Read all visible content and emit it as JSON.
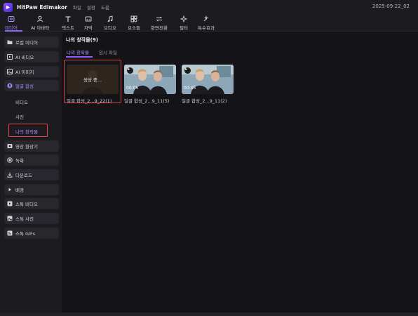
{
  "titlebar": {
    "app_name": "HitPaw Edimakor",
    "menus": [
      "파일",
      "설정",
      "도움"
    ],
    "date": "2025-09-22_02"
  },
  "toolbar": {
    "items": [
      {
        "label": "미디어",
        "icon": "media-icon",
        "active": true
      },
      {
        "label": "AI 아바타",
        "icon": "avatar-icon",
        "active": false
      },
      {
        "label": "텍스트",
        "icon": "text-icon",
        "active": false
      },
      {
        "label": "자막",
        "icon": "subtitle-icon",
        "active": false
      },
      {
        "label": "오디오",
        "icon": "audio-icon",
        "active": false
      },
      {
        "label": "요소들",
        "icon": "elements-icon",
        "active": false
      },
      {
        "label": "화면전환",
        "icon": "transition-icon",
        "active": false
      },
      {
        "label": "필터",
        "icon": "filter-icon",
        "active": false
      },
      {
        "label": "특수효과",
        "icon": "effects-icon",
        "active": false
      }
    ]
  },
  "sidebar": {
    "items": [
      {
        "label": "로컬 미디어",
        "icon": "folder-icon"
      },
      {
        "label": "AI 비디오",
        "icon": "ai-video-icon"
      },
      {
        "label": "AI 이미지",
        "icon": "ai-image-icon"
      },
      {
        "label": "얼굴 합성",
        "icon": "face-swap-icon",
        "active": true
      },
      {
        "label": "영상 향상기",
        "icon": "enhancer-icon"
      },
      {
        "label": "녹화",
        "icon": "record-icon"
      },
      {
        "label": "다운로드",
        "icon": "download-icon"
      },
      {
        "label": "배경",
        "icon": "background-icon"
      },
      {
        "label": "스톡 비디오",
        "icon": "stock-video-icon"
      },
      {
        "label": "스톡 사진",
        "icon": "stock-photo-icon"
      },
      {
        "label": "스톡 GIFs",
        "icon": "stock-gif-icon"
      }
    ],
    "subitems": [
      {
        "label": "비디오"
      },
      {
        "label": "사진"
      },
      {
        "label": "나의 창작물",
        "active": true
      }
    ]
  },
  "main": {
    "title": "나의 창작물(9)",
    "tabs": [
      {
        "label": "나의 창작물",
        "active": true
      },
      {
        "label": "임시 파일",
        "active": false
      }
    ],
    "cards": [
      {
        "label": "얼굴 합성_2...9_22(1)",
        "overlay": "생성 중...",
        "duration": "",
        "status": "generating"
      },
      {
        "label": "얼굴 합성_2...9_11(5)",
        "overlay": "",
        "duration": "00:05",
        "status": "done"
      },
      {
        "label": "얼굴 합성_2...9_11(2)",
        "overlay": "",
        "duration": "00:05",
        "status": "done"
      }
    ]
  },
  "colors": {
    "accent": "#8b63ff",
    "highlight_box": "#e04848",
    "background": "#141418",
    "panel": "#1b1b20"
  }
}
